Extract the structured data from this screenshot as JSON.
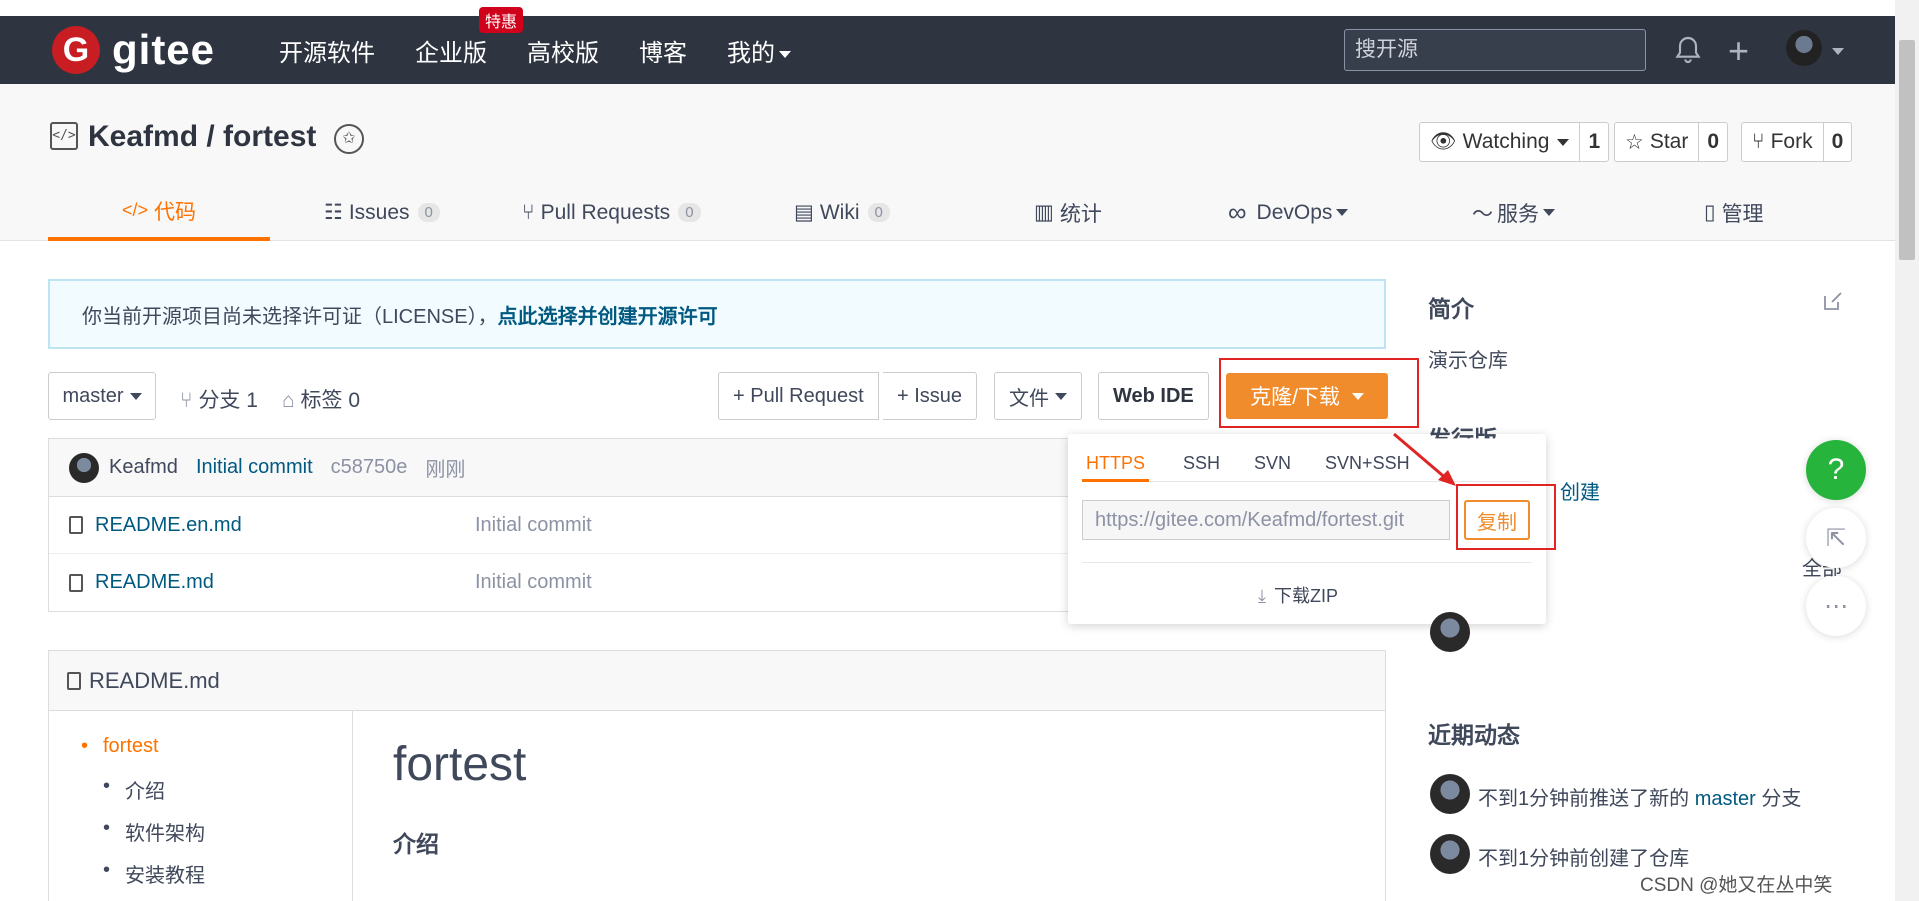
{
  "nav": {
    "logo_text": "gitee",
    "items": [
      {
        "label": "开源软件"
      },
      {
        "label": "企业版",
        "badge": "特惠"
      },
      {
        "label": "高校版"
      },
      {
        "label": "博客"
      },
      {
        "label": "我的"
      }
    ],
    "search_placeholder": "搜开源"
  },
  "repo": {
    "icon": "</>",
    "title": "Keafmd / fortest",
    "watching_label": "Watching",
    "watching_count": "1",
    "star_label": "Star",
    "star_count": "0",
    "fork_label": "Fork",
    "fork_count": "0"
  },
  "tabs": [
    {
      "label": "代码",
      "icon": "</>"
    },
    {
      "label": "Issues",
      "count": "0"
    },
    {
      "label": "Pull Requests",
      "count": "0"
    },
    {
      "label": "Wiki",
      "count": "0"
    },
    {
      "label": "统计"
    },
    {
      "label": "DevOps"
    },
    {
      "label": "服务"
    },
    {
      "label": "管理"
    }
  ],
  "notice": {
    "text": "你当前开源项目尚未选择许可证（LICENSE），",
    "link": "点此选择并创建开源许可"
  },
  "toolbar": {
    "branch": "master",
    "branches": "分支 1",
    "tags": "标签 0",
    "pull_request": "+ Pull Request",
    "issue": "+ Issue",
    "file": "文件",
    "web_ide": "Web IDE",
    "clone": "克隆/下载"
  },
  "commit": {
    "author": "Keafmd",
    "message": "Initial commit",
    "hash": "c58750e",
    "time": "刚刚"
  },
  "files": [
    {
      "name": "README.en.md",
      "message": "Initial commit"
    },
    {
      "name": "README.md",
      "message": "Initial commit"
    }
  ],
  "clone_popup": {
    "tabs": [
      "HTTPS",
      "SSH",
      "SVN",
      "SVN+SSH"
    ],
    "url": "https://gitee.com/Keafmd/fortest.git",
    "copy": "复制",
    "download_zip": "下载ZIP"
  },
  "readme": {
    "header": "README.md",
    "toc": [
      "fortest",
      "介绍",
      "软件架构",
      "安装教程"
    ],
    "h1": "fortest",
    "h2": "介绍"
  },
  "sidebar": {
    "intro_title": "简介",
    "intro_text": "演示仓库",
    "release_title": "发行版",
    "release_link": "创建",
    "all_link": "全部",
    "activity_title": "近期动态",
    "activities": [
      "不到1分钟前推送了新的",
      "不到1分钟前创建了仓库"
    ],
    "activity_branch": "master",
    "activity_suffix": "分支",
    "help": "?"
  },
  "watermark": "CSDN @她又在丛中笑",
  "colors": {
    "accent": "#fe7300",
    "nav_bg": "#2e3440",
    "brand": "#c71d23",
    "help": "#26b43c"
  }
}
